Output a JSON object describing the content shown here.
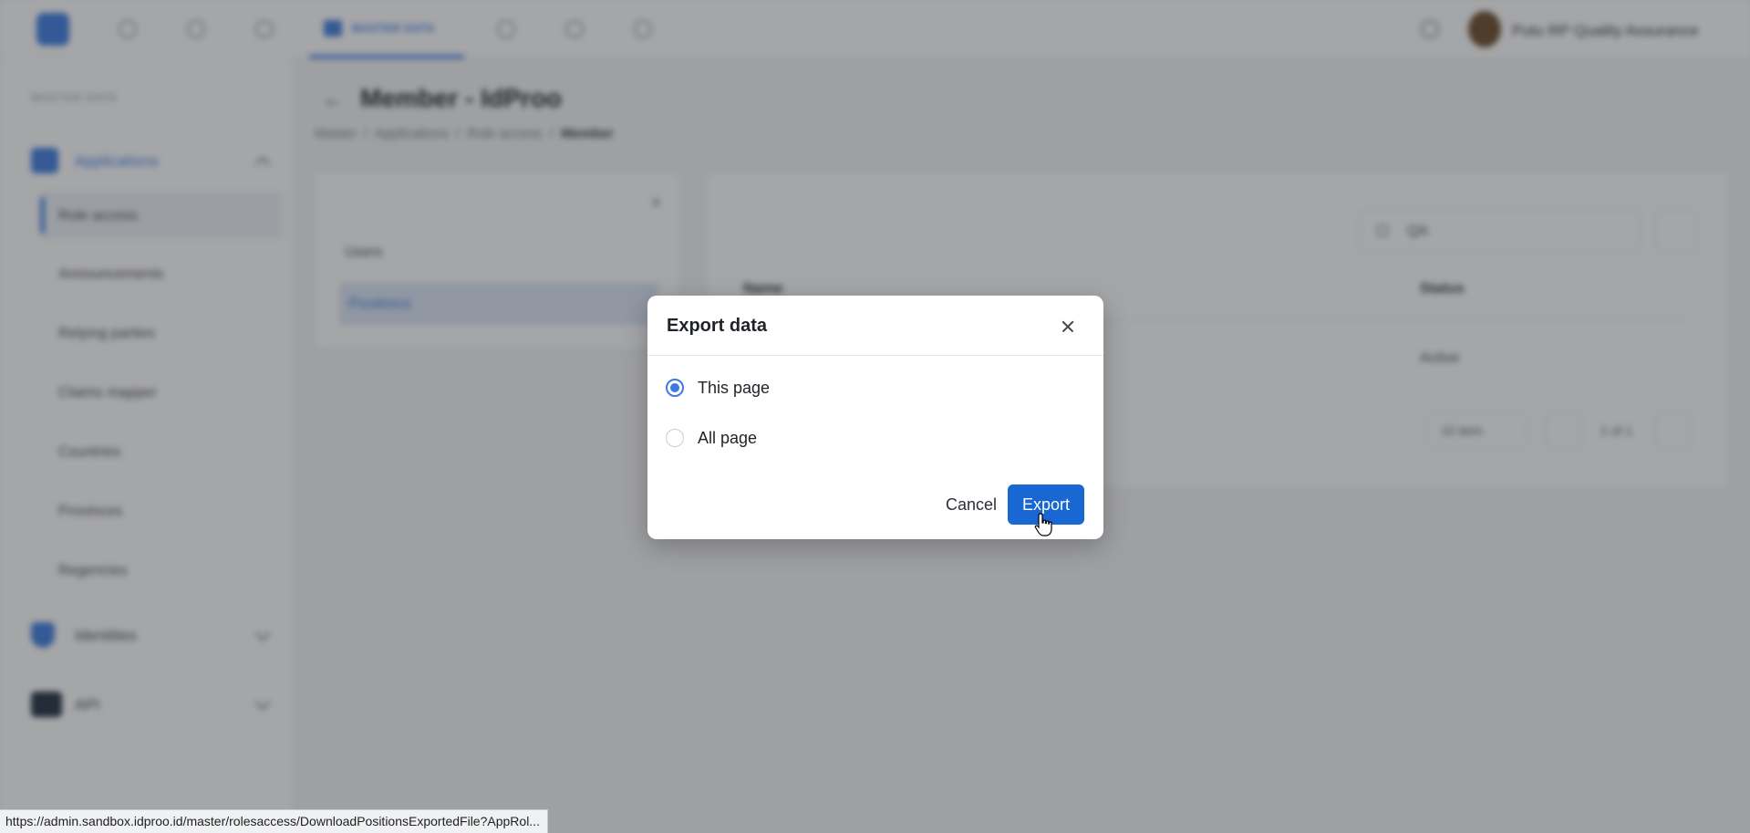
{
  "topbar": {
    "active_tab_label": "MASTER DATA",
    "user_name": "Putu RP Quality Assurance"
  },
  "sidebar": {
    "section_title": "MASTER DATA",
    "groups": [
      {
        "label": "Applications",
        "icon": "applications-icon",
        "color": "#3d7be0"
      },
      {
        "label": "Identities",
        "icon": "shield-icon",
        "color": "#3d7be0"
      },
      {
        "label": "API",
        "icon": "api-icon",
        "color": "#1f2d3d"
      }
    ],
    "items": [
      "Role access",
      "Announcements",
      "Relying parties",
      "Claims mapper",
      "Countries",
      "Provinces",
      "Regencies"
    ]
  },
  "page": {
    "title": "Member - IdProo",
    "breadcrumb": [
      "Master",
      "Applications",
      "Role access",
      "Member"
    ]
  },
  "left_panel": {
    "items": [
      "Users",
      "Positions"
    ]
  },
  "table": {
    "search_value": "QA",
    "columns": [
      "Name",
      "Status"
    ],
    "rows": [
      {
        "status": "Active"
      }
    ],
    "page_size": "10 item",
    "page_info": "1 of 1"
  },
  "modal": {
    "title": "Export data",
    "options": [
      {
        "label": "This page",
        "selected": true
      },
      {
        "label": "All page",
        "selected": false
      }
    ],
    "cancel_label": "Cancel",
    "export_label": "Export"
  },
  "statusbar": {
    "url": "https://admin.sandbox.idproo.id/master/rolesaccess/DownloadPositionsExportedFile?AppRol..."
  },
  "colors": {
    "accent": "#3d7be0",
    "primary_button": "#1967d2",
    "overlay": "rgba(40, 42, 48, 0.42)"
  }
}
